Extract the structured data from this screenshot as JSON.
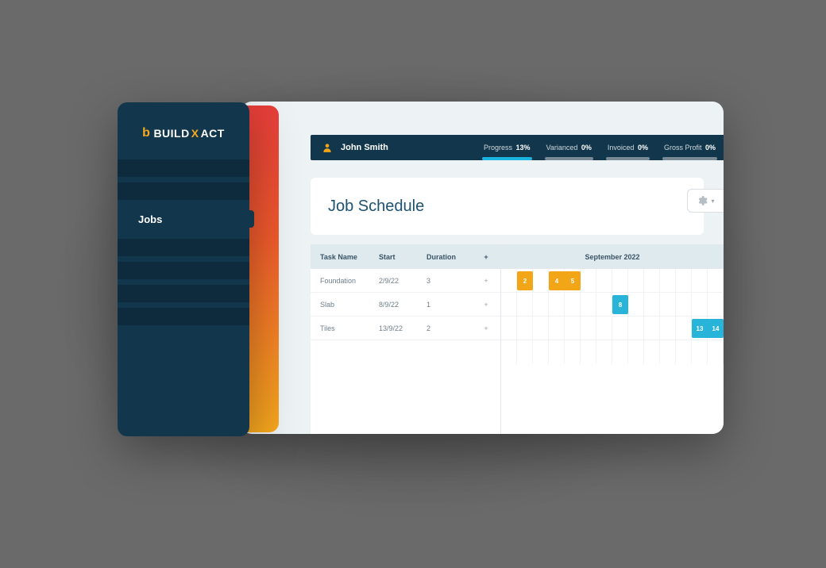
{
  "brand": {
    "prefix": "BUILD",
    "suffix": "ACT"
  },
  "sidebar": {
    "active_label": "Jobs"
  },
  "header": {
    "owner": "John Smith",
    "stats": [
      {
        "label": "Progress",
        "value": "13%"
      },
      {
        "label": "Varianced",
        "value": "0%"
      },
      {
        "label": "Invoiced",
        "value": "0%"
      },
      {
        "label": "Gross Profit",
        "value": "0%"
      }
    ]
  },
  "page_title": "Job Schedule",
  "columns": {
    "task": "Task Name",
    "start": "Start",
    "duration": "Duration",
    "plus": "+"
  },
  "calendar": {
    "month": "September 2022",
    "days_visible": 14
  },
  "tasks": [
    {
      "name": "Foundation",
      "start": "2/9/22",
      "duration": "3",
      "bars": [
        {
          "row": 0,
          "day_from": 2,
          "days": [
            "2"
          ],
          "color": "orange",
          "width_days": 1
        },
        {
          "row": 0,
          "day_from": 4,
          "days": [
            "4",
            "5"
          ],
          "color": "orange",
          "width_days": 2
        }
      ]
    },
    {
      "name": "Slab",
      "start": "8/9/22",
      "duration": "1",
      "bars": [
        {
          "row": 1,
          "day_from": 8,
          "days": [
            "8"
          ],
          "color": "cyan",
          "width_days": 1
        }
      ]
    },
    {
      "name": "Tiles",
      "start": "13/9/22",
      "duration": "2",
      "bars": [
        {
          "row": 2,
          "day_from": 13,
          "days": [
            "13",
            "14"
          ],
          "color": "cyan",
          "width_days": 2
        }
      ]
    }
  ],
  "colors": {
    "navy": "#12374c",
    "orange": "#f2a516",
    "cyan": "#28b4d8"
  }
}
